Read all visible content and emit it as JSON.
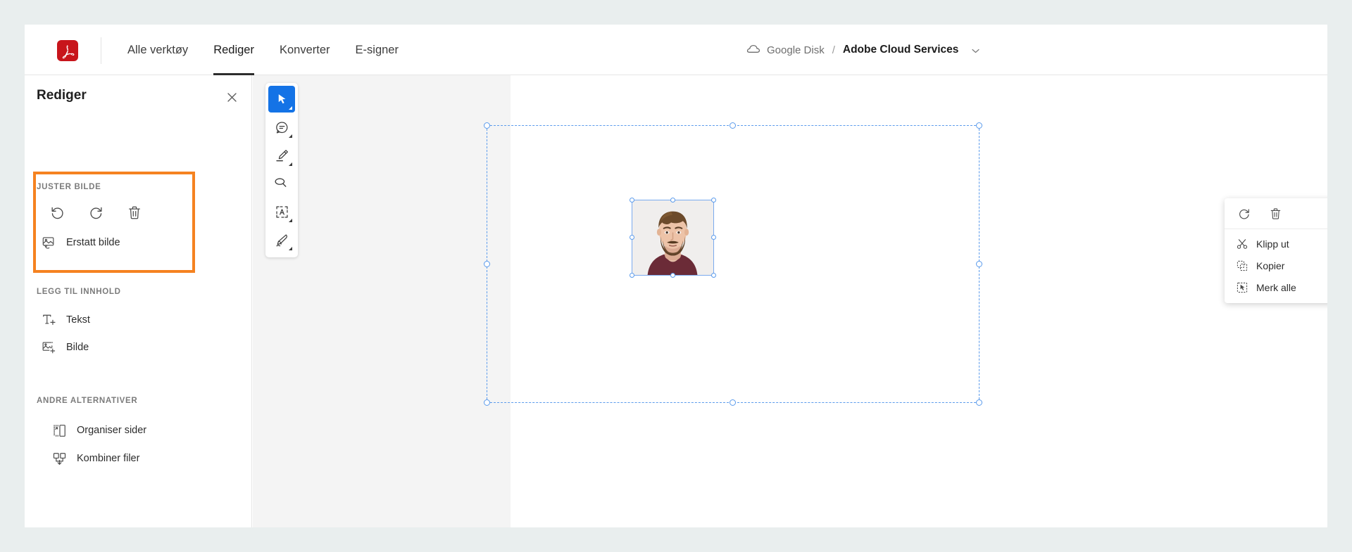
{
  "colors": {
    "app_background": "#e9eeee",
    "adobe_red": "#c8151b",
    "highlight_orange": "#f58220",
    "active_tool_blue": "#1473e6",
    "selection_blue": "#5b9bec"
  },
  "topbar": {
    "logo_icon": "adobe-acrobat-logo",
    "tabs": [
      {
        "label": "Alle verktøy",
        "active": false
      },
      {
        "label": "Rediger",
        "active": true
      },
      {
        "label": "Konverter",
        "active": false
      },
      {
        "label": "E-signer",
        "active": false
      }
    ],
    "breadcrumb": {
      "cloud_icon": "cloud-icon",
      "source": "Google Disk",
      "separator": "/",
      "current": "Adobe Cloud Services",
      "chevron_icon": "chevron-down-icon"
    }
  },
  "left_panel": {
    "title": "Rediger",
    "close_icon": "close-icon",
    "sections": [
      {
        "label": "JUSTER BILDE",
        "highlighted": true,
        "icon_buttons": [
          {
            "name": "rotate-left-icon",
            "title": "Roter mot venstre"
          },
          {
            "name": "rotate-right-icon",
            "title": "Roter mot høyre"
          },
          {
            "name": "delete-icon",
            "title": "Slett"
          }
        ],
        "items": [
          {
            "label": "Erstatt bilde",
            "icon": "replace-image-icon"
          }
        ]
      },
      {
        "label": "LEGG TIL INNHOLD",
        "highlighted": false,
        "items": [
          {
            "label": "Tekst",
            "icon": "add-text-icon"
          },
          {
            "label": "Bilde",
            "icon": "add-image-icon"
          }
        ]
      },
      {
        "label": "ANDRE ALTERNATIVER",
        "highlighted": false,
        "items": [
          {
            "label": "Organiser sider",
            "icon": "organize-pages-icon"
          },
          {
            "label": "Kombiner filer",
            "icon": "combine-files-icon"
          }
        ]
      }
    ]
  },
  "vertical_toolbar": {
    "tools": [
      {
        "name": "select-cursor-icon",
        "label": "Velg",
        "active": true,
        "has_caret": true
      },
      {
        "name": "comment-bubble-icon",
        "label": "Kommentar",
        "active": false,
        "has_caret": true
      },
      {
        "name": "highlighter-icon",
        "label": "Uthev",
        "active": false,
        "has_caret": true
      },
      {
        "name": "lasso-eraser-icon",
        "label": "Viskelær",
        "active": false,
        "has_caret": false
      },
      {
        "name": "text-box-select-icon",
        "label": "Merk tekst",
        "active": false,
        "has_caret": true
      },
      {
        "name": "signature-pen-icon",
        "label": "Signer",
        "active": false,
        "has_caret": true
      }
    ]
  },
  "document": {
    "page_selected": true,
    "image_selected": true,
    "image_alt": "Portrett av skjeggete mann i mørkerød t-skjorte"
  },
  "context_menu": {
    "icon_buttons": [
      {
        "name": "rotate-right-icon",
        "title": "Roter"
      },
      {
        "name": "delete-icon",
        "title": "Slett"
      }
    ],
    "items": [
      {
        "label": "Klipp ut",
        "icon": "scissors-icon"
      },
      {
        "label": "Kopier",
        "icon": "copy-icon"
      },
      {
        "label": "Merk alle",
        "icon": "select-all-icon"
      }
    ]
  }
}
